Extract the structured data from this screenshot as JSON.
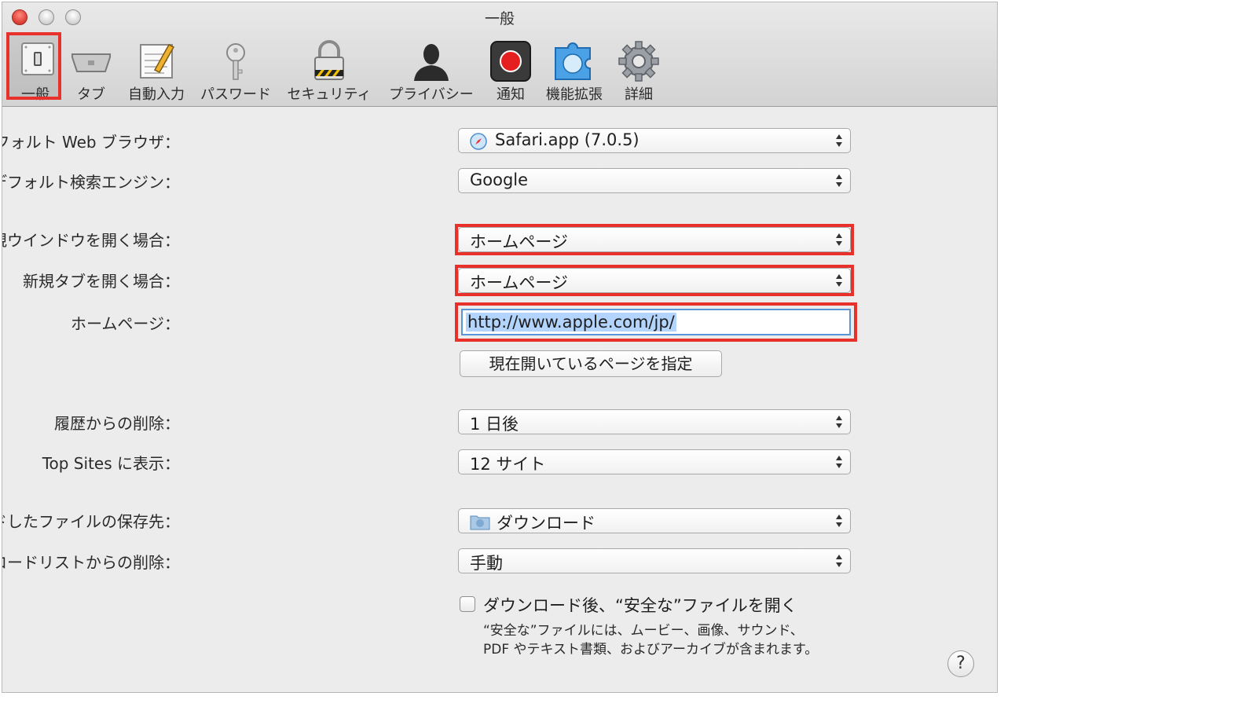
{
  "window": {
    "title": "一般"
  },
  "toolbar": {
    "items": [
      {
        "label": "一般",
        "icon": "general-switch-icon",
        "selected": true
      },
      {
        "label": "タブ",
        "icon": "tabs-icon"
      },
      {
        "label": "自動入力",
        "icon": "autofill-icon"
      },
      {
        "label": "パスワード",
        "icon": "password-key-icon"
      },
      {
        "label": "セキュリティ",
        "icon": "security-lock-icon"
      },
      {
        "label": "プライバシー",
        "icon": "privacy-silhouette-icon"
      },
      {
        "label": "通知",
        "icon": "notifications-icon"
      },
      {
        "label": "機能拡張",
        "icon": "extensions-puzzle-icon"
      },
      {
        "label": "詳細",
        "icon": "advanced-gear-icon"
      }
    ]
  },
  "settings": {
    "default_browser": {
      "label": "デフォルト Web ブラウザ：",
      "value": "Safari.app (7.0.5)"
    },
    "default_search": {
      "label": "デフォルト検索エンジン：",
      "value": "Google"
    },
    "new_window": {
      "label": "新規ウインドウを開く場合：",
      "value": "ホームページ"
    },
    "new_tab": {
      "label": "新規タブを開く場合：",
      "value": "ホームページ"
    },
    "homepage": {
      "label": "ホームページ：",
      "value": "http://www.apple.com/jp/"
    },
    "set_current_button": "現在開いているページを指定",
    "history_remove": {
      "label": "履歴からの削除：",
      "value": "1 日後"
    },
    "top_sites": {
      "label": "Top Sites に表示：",
      "value": "12 サイト"
    },
    "download_location": {
      "label": "ダウンロードしたファイルの保存先：",
      "value": "ダウンロード"
    },
    "download_list_remove": {
      "label": "ダウンロードリストからの削除：",
      "value": "手動"
    },
    "open_safe_files": {
      "label": "ダウンロード後、“安全な”ファイルを開く",
      "checked": false,
      "note_line1": "“安全な”ファイルには、ムービー、画像、サウンド、",
      "note_line2": "PDF やテキスト書類、およびアーカイブが含まれます。"
    }
  },
  "help_button": "?",
  "colors": {
    "highlight": "#e8312a",
    "focus": "#5b94d8",
    "selection": "#b3d4fc"
  }
}
